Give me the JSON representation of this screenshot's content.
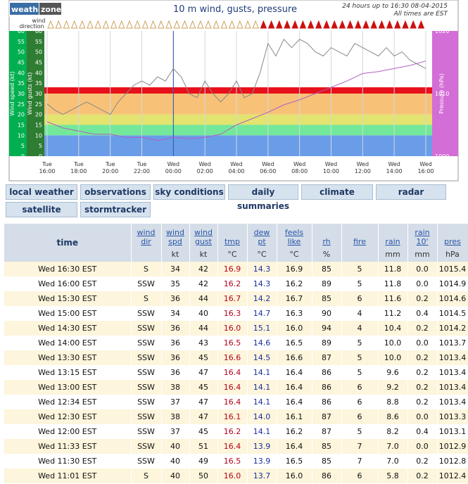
{
  "header": {
    "logo_left": "weather",
    "logo_right": "zone",
    "title": "10 m wind, gusts, pressure",
    "subtitle_line1": "24 hours up to 16:30 08-04-2015",
    "subtitle_line2": "All times are EST",
    "wind_direction_label_1": "wind",
    "wind_direction_label_2": "direction"
  },
  "chart_data": {
    "type": "line",
    "title": "10 m wind, gusts, pressure",
    "left_axis_1": {
      "label": "Wind speed (kt)",
      "ticks": [
        0,
        5,
        10,
        15,
        20,
        25,
        30,
        35,
        40,
        45,
        50,
        55,
        60
      ]
    },
    "left_axis_2": {
      "label": "Wind gusts (kt)",
      "ticks": [
        0,
        5,
        10,
        15,
        20,
        25,
        30,
        35,
        40,
        45,
        50,
        55,
        60
      ]
    },
    "right_axis": {
      "label": "Pressure (hPa)",
      "ticks": [
        1000,
        1010,
        1020
      ],
      "ylim": [
        1000,
        1020
      ]
    },
    "ylim": [
      0,
      60
    ],
    "x_ticks": [
      {
        "day": "Tue",
        "time": "16:00"
      },
      {
        "day": "Tue",
        "time": "18:00"
      },
      {
        "day": "Tue",
        "time": "20:00"
      },
      {
        "day": "Tue",
        "time": "22:00"
      },
      {
        "day": "Wed",
        "time": "00:00"
      },
      {
        "day": "Wed",
        "time": "02:00"
      },
      {
        "day": "Wed",
        "time": "04:00"
      },
      {
        "day": "Wed",
        "time": "06:00"
      },
      {
        "day": "Wed",
        "time": "08:00"
      },
      {
        "day": "Wed",
        "time": "10:00"
      },
      {
        "day": "Wed",
        "time": "12:00"
      },
      {
        "day": "Wed",
        "time": "14:00"
      },
      {
        "day": "Wed",
        "time": "16:00"
      }
    ],
    "bands": [
      {
        "from": 0,
        "to": 10,
        "color": "#6a9de8"
      },
      {
        "from": 10,
        "to": 15,
        "color": "#73e89a"
      },
      {
        "from": 15,
        "to": 20,
        "color": "#e3e370"
      },
      {
        "from": 20,
        "to": 30,
        "color": "#f7c278"
      },
      {
        "from": 30,
        "to": 60,
        "color": "#e8101a"
      }
    ],
    "series": [
      {
        "color": "#888888",
        "x_hours": [
          0,
          0.5,
          1,
          1.5,
          2,
          2.5,
          3,
          3.5,
          4,
          4.5,
          5,
          5.5,
          6,
          6.5,
          7,
          7.5,
          8,
          8.5,
          9,
          9.5,
          10,
          10.5,
          11,
          11.5,
          12,
          12.5,
          13,
          13.5,
          14,
          14.5,
          15,
          15.5,
          16,
          16.5,
          17,
          17.5,
          18,
          18.5,
          19,
          19.5,
          20,
          20.5,
          21,
          21.5,
          22,
          22.5,
          23,
          23.5,
          24
        ],
        "values": [
          25,
          22,
          20,
          22,
          24,
          26,
          24,
          22,
          20,
          26,
          30,
          34,
          36,
          34,
          38,
          36,
          42,
          38,
          30,
          28,
          36,
          30,
          26,
          30,
          36,
          28,
          30,
          40,
          54,
          48,
          56,
          52,
          56,
          54,
          50,
          48,
          52,
          50,
          48,
          54,
          52,
          50,
          48,
          52,
          48,
          50,
          46,
          44,
          42
        ]
      },
      {
        "color": "#b060c0",
        "x_hours": [
          0,
          1,
          2,
          3,
          4,
          5,
          6,
          7,
          8,
          9,
          10,
          11,
          12,
          13,
          14,
          15,
          16,
          17,
          18,
          19,
          20,
          21,
          22,
          23,
          24
        ],
        "values": [
          1005.5,
          1004.5,
          1004,
          1003.5,
          1003.5,
          1003,
          1003,
          1002.5,
          1003,
          1002.8,
          1003,
          1003.5,
          1005,
          1006,
          1007,
          1008.2,
          1009,
          1010,
          1011,
          1012,
          1013.2,
          1013.5,
          1014,
          1014.5,
          1015.2
        ]
      }
    ]
  },
  "nav": {
    "row1": [
      "local weather",
      "observations",
      "sky conditions",
      "daily summaries",
      "climate",
      "radar"
    ],
    "row2": [
      "satellite",
      "stormtracker"
    ]
  },
  "table": {
    "headers": [
      {
        "l1": "time",
        "l2": "",
        "unit": ""
      },
      {
        "l1": "wind",
        "l2": "dir",
        "unit": ""
      },
      {
        "l1": "wind",
        "l2": "spd",
        "unit": "kt"
      },
      {
        "l1": "wind",
        "l2": "gust",
        "unit": "kt"
      },
      {
        "l1": "tmp",
        "l2": "",
        "unit": "°C"
      },
      {
        "l1": "dew",
        "l2": "pt",
        "unit": "°C"
      },
      {
        "l1": "feels",
        "l2": "like",
        "unit": "°C"
      },
      {
        "l1": "rh",
        "l2": "",
        "unit": "%"
      },
      {
        "l1": "fire",
        "l2": "",
        "unit": ""
      },
      {
        "l1": "rain",
        "l2": "",
        "unit": "mm"
      },
      {
        "l1": "rain",
        "l2": "10'",
        "unit": "mm"
      },
      {
        "l1": "pres",
        "l2": "",
        "unit": "hPa"
      }
    ],
    "rows": [
      [
        "Wed 16:30 EST",
        "S",
        "34",
        "42",
        "16.9",
        "14.3",
        "16.9",
        "85",
        "5",
        "11.8",
        "0.0",
        "1015.4"
      ],
      [
        "Wed 16:00 EST",
        "SSW",
        "35",
        "42",
        "16.2",
        "14.3",
        "16.2",
        "89",
        "5",
        "11.8",
        "0.0",
        "1014.9"
      ],
      [
        "Wed 15:30 EST",
        "S",
        "36",
        "44",
        "16.7",
        "14.2",
        "16.7",
        "85",
        "6",
        "11.6",
        "0.2",
        "1014.6"
      ],
      [
        "Wed 15:00 EST",
        "SSW",
        "34",
        "40",
        "16.3",
        "14.7",
        "16.3",
        "90",
        "4",
        "11.2",
        "0.4",
        "1014.5"
      ],
      [
        "Wed 14:30 EST",
        "SSW",
        "36",
        "44",
        "16.0",
        "15.1",
        "16.0",
        "94",
        "4",
        "10.4",
        "0.2",
        "1014.2"
      ],
      [
        "Wed 14:00 EST",
        "SSW",
        "36",
        "43",
        "16.5",
        "14.6",
        "16.5",
        "89",
        "5",
        "10.0",
        "0.0",
        "1013.7"
      ],
      [
        "Wed 13:30 EST",
        "SSW",
        "36",
        "45",
        "16.6",
        "14.5",
        "16.6",
        "87",
        "5",
        "10.0",
        "0.2",
        "1013.4"
      ],
      [
        "Wed 13:15 EST",
        "SSW",
        "36",
        "47",
        "16.4",
        "14.1",
        "16.4",
        "86",
        "5",
        "9.6",
        "0.2",
        "1013.4"
      ],
      [
        "Wed 13:00 EST",
        "SSW",
        "38",
        "45",
        "16.4",
        "14.1",
        "16.4",
        "86",
        "6",
        "9.2",
        "0.2",
        "1013.4"
      ],
      [
        "Wed 12:34 EST",
        "SSW",
        "37",
        "47",
        "16.4",
        "14.1",
        "16.4",
        "86",
        "6",
        "8.8",
        "0.2",
        "1013.4"
      ],
      [
        "Wed 12:30 EST",
        "SSW",
        "38",
        "47",
        "16.1",
        "14.0",
        "16.1",
        "87",
        "6",
        "8.6",
        "0.0",
        "1013.3"
      ],
      [
        "Wed 12:00 EST",
        "SSW",
        "37",
        "45",
        "16.2",
        "14.1",
        "16.2",
        "87",
        "5",
        "8.2",
        "0.4",
        "1013.1"
      ],
      [
        "Wed 11:33 EST",
        "SSW",
        "40",
        "51",
        "16.4",
        "13.9",
        "16.4",
        "85",
        "7",
        "7.0",
        "0.0",
        "1012.9"
      ],
      [
        "Wed 11:30 EST",
        "SSW",
        "40",
        "49",
        "16.5",
        "13.9",
        "16.5",
        "85",
        "7",
        "7.0",
        "0.2",
        "1012.8"
      ],
      [
        "Wed 11:01 EST",
        "S",
        "40",
        "50",
        "16.0",
        "13.7",
        "16.0",
        "86",
        "6",
        "5.8",
        "0.2",
        "1012.4"
      ]
    ]
  }
}
